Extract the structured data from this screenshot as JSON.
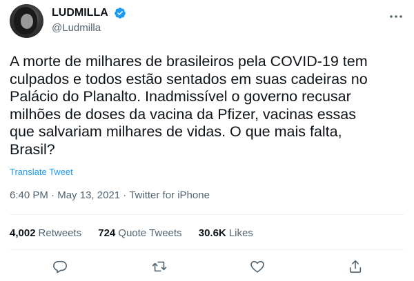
{
  "author": {
    "display_name": "LUDMILLA",
    "handle": "@Ludmilla"
  },
  "tweet": {
    "text": "A morte de milhares de brasileiros pela COVID-19 tem\nculpados e todos estão sentados em suas cadeiras no\nPalácio do Planalto. Inadmissível o governo recusar\nmilhões de doses da vacina da Pfizer, vacinas essas\nque salvariam milhares de vidas. O que mais falta,\nBrasil?",
    "translate_label": "Translate Tweet",
    "time": "6:40 PM",
    "date": "May 13, 2021",
    "source": "Twitter for iPhone",
    "separator": "·"
  },
  "stats": {
    "retweets_count": "4,002",
    "retweets_label": "Retweets",
    "quotes_count": "724",
    "quotes_label": "Quote Tweets",
    "likes_count": "30.6K",
    "likes_label": "Likes"
  },
  "icons": {
    "verified": "verified-badge-icon",
    "more": "more-options-icon",
    "reply": "reply-icon",
    "retweet": "retweet-icon",
    "like": "heart-icon",
    "share": "share-icon"
  },
  "colors": {
    "accent": "#1d9bf0",
    "secondary_text": "#536471",
    "divider": "#eff3f4"
  }
}
